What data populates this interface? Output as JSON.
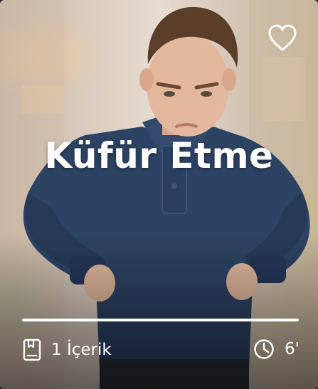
{
  "card": {
    "title": "Küfür Etme",
    "favorite_icon": "heart-outline-icon",
    "progress": 1.0,
    "content_icon": "book-icon",
    "content_count": "1 İçerik",
    "duration_icon": "clock-icon",
    "duration": "6'"
  },
  "colors": {
    "text": "#ffffff",
    "shirt": "#2d4364",
    "hair": "#5a3e2a",
    "skin": "#e3b89d"
  }
}
